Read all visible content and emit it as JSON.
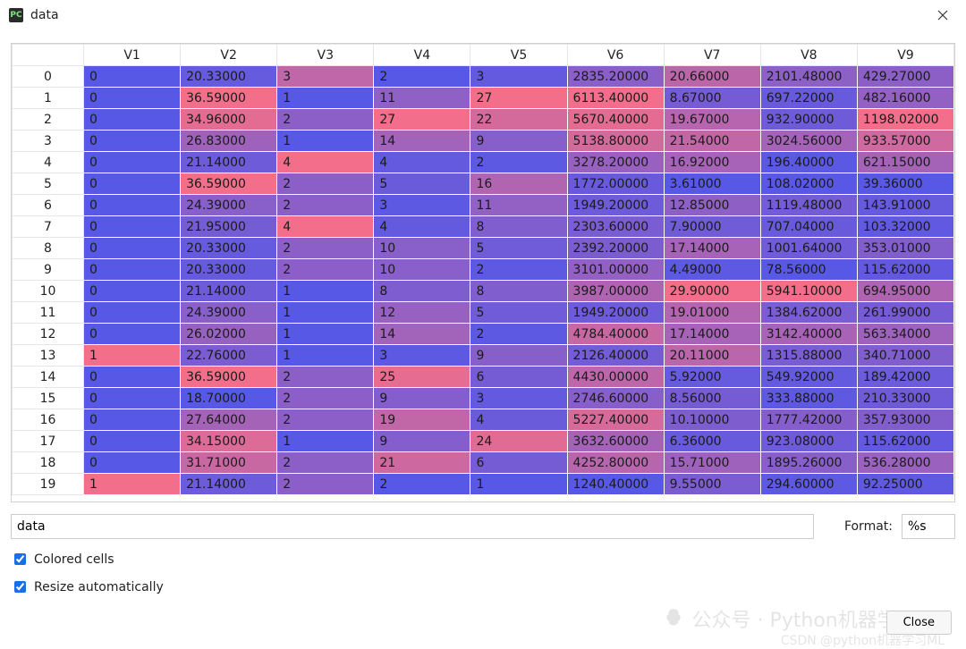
{
  "window": {
    "title": "data",
    "app_icon_text": "PC"
  },
  "color_ramp": {
    "low": "#5858e6",
    "high": "#f26e8a"
  },
  "table": {
    "columns": [
      "V1",
      "V2",
      "V3",
      "V4",
      "V5",
      "V6",
      "V7",
      "V8",
      "V9"
    ],
    "rows": [
      {
        "idx": 0,
        "cells": [
          "0",
          "20.33000",
          "3",
          "2",
          "3",
          "2835.20000",
          "20.66000",
          "2101.48000",
          "429.27000"
        ]
      },
      {
        "idx": 1,
        "cells": [
          "0",
          "36.59000",
          "1",
          "11",
          "27",
          "6113.40000",
          "8.67000",
          "697.22000",
          "482.16000"
        ]
      },
      {
        "idx": 2,
        "cells": [
          "0",
          "34.96000",
          "2",
          "27",
          "22",
          "5670.40000",
          "19.67000",
          "932.90000",
          "1198.02000"
        ]
      },
      {
        "idx": 3,
        "cells": [
          "0",
          "26.83000",
          "1",
          "14",
          "9",
          "5138.80000",
          "21.54000",
          "3024.56000",
          "933.57000"
        ]
      },
      {
        "idx": 4,
        "cells": [
          "0",
          "21.14000",
          "4",
          "4",
          "2",
          "3278.20000",
          "16.92000",
          "196.40000",
          "621.15000"
        ]
      },
      {
        "idx": 5,
        "cells": [
          "0",
          "36.59000",
          "2",
          "5",
          "16",
          "1772.00000",
          "3.61000",
          "108.02000",
          "39.36000"
        ]
      },
      {
        "idx": 6,
        "cells": [
          "0",
          "24.39000",
          "2",
          "3",
          "11",
          "1949.20000",
          "12.85000",
          "1119.48000",
          "143.91000"
        ]
      },
      {
        "idx": 7,
        "cells": [
          "0",
          "21.95000",
          "4",
          "4",
          "8",
          "2303.60000",
          "7.90000",
          "707.04000",
          "103.32000"
        ]
      },
      {
        "idx": 8,
        "cells": [
          "0",
          "20.33000",
          "2",
          "10",
          "5",
          "2392.20000",
          "17.14000",
          "1001.64000",
          "353.01000"
        ]
      },
      {
        "idx": 9,
        "cells": [
          "0",
          "20.33000",
          "2",
          "10",
          "2",
          "3101.00000",
          "4.49000",
          "78.56000",
          "115.62000"
        ]
      },
      {
        "idx": 10,
        "cells": [
          "0",
          "21.14000",
          "1",
          "8",
          "8",
          "3987.00000",
          "29.90000",
          "5941.10000",
          "694.95000"
        ]
      },
      {
        "idx": 11,
        "cells": [
          "0",
          "24.39000",
          "1",
          "12",
          "5",
          "1949.20000",
          "19.01000",
          "1384.62000",
          "261.99000"
        ]
      },
      {
        "idx": 12,
        "cells": [
          "0",
          "26.02000",
          "1",
          "14",
          "2",
          "4784.40000",
          "17.14000",
          "3142.40000",
          "563.34000"
        ]
      },
      {
        "idx": 13,
        "cells": [
          "1",
          "22.76000",
          "1",
          "3",
          "9",
          "2126.40000",
          "20.11000",
          "1315.88000",
          "340.71000"
        ]
      },
      {
        "idx": 14,
        "cells": [
          "0",
          "36.59000",
          "2",
          "25",
          "6",
          "4430.00000",
          "5.92000",
          "549.92000",
          "189.42000"
        ]
      },
      {
        "idx": 15,
        "cells": [
          "0",
          "18.70000",
          "2",
          "9",
          "3",
          "2746.60000",
          "8.56000",
          "333.88000",
          "210.33000"
        ]
      },
      {
        "idx": 16,
        "cells": [
          "0",
          "27.64000",
          "2",
          "19",
          "4",
          "5227.40000",
          "10.10000",
          "1777.42000",
          "357.93000"
        ]
      },
      {
        "idx": 17,
        "cells": [
          "0",
          "34.15000",
          "1",
          "9",
          "24",
          "3632.60000",
          "6.36000",
          "923.08000",
          "115.62000"
        ]
      },
      {
        "idx": 18,
        "cells": [
          "0",
          "31.71000",
          "2",
          "21",
          "6",
          "4252.80000",
          "15.71000",
          "1895.26000",
          "536.28000"
        ]
      },
      {
        "idx": 19,
        "cells": [
          "1",
          "21.14000",
          "2",
          "2",
          "1",
          "1240.40000",
          "9.55000",
          "294.60000",
          "92.25000"
        ]
      }
    ]
  },
  "bottom": {
    "name_field": "data",
    "format_label": "Format:",
    "format_field": "%s",
    "colored_cells_label": "Colored cells",
    "resize_label": "Resize automatically",
    "colored_cells_checked": true,
    "resize_checked": true,
    "close_button": "Close"
  },
  "watermark": {
    "line1": "公众号 · Python机器学习ML",
    "line2": "CSDN @python机器学习ML"
  }
}
